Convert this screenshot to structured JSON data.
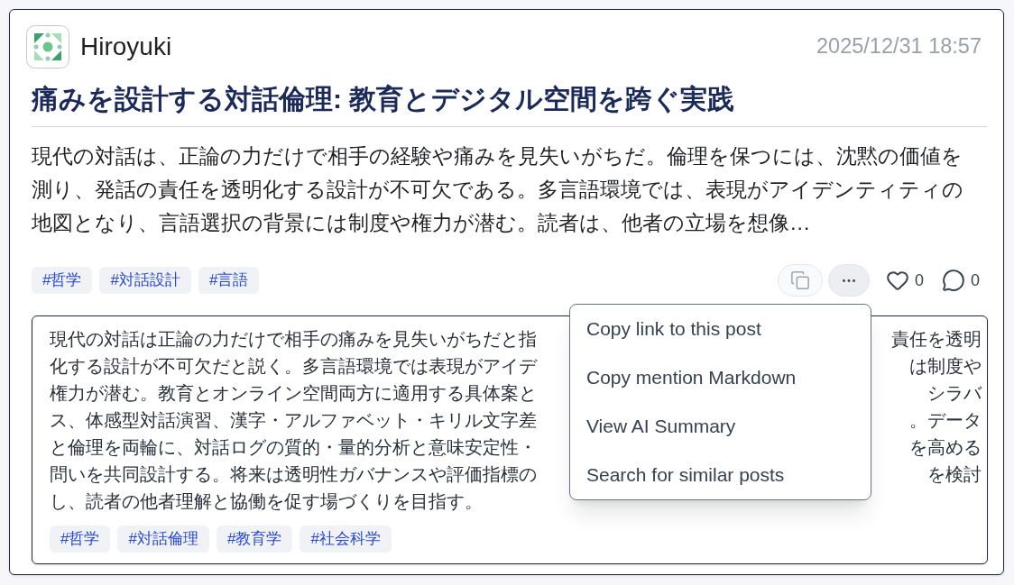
{
  "post": {
    "author": "Hiroyuki",
    "timestamp": "2025/12/31 18:57",
    "title": "痛みを設計する対話倫理: 教育とデジタル空間を跨ぐ実践",
    "body_lines": [
      "現代の対話は、正論の力だけで相手の経験や痛みを見失いがちだ。倫理を保つには、沈黙の価値を",
      "測り、発話の責任を透明化する設計が不可欠である。多言語環境では、表現がアイデンティティの",
      "地図となり、言語選択の背景には制度や権力が潜む。読者は、他者の立場を想像…"
    ],
    "tags": [
      "#哲学",
      "#対話設計",
      "#言語"
    ],
    "likes": "0",
    "comments": "0",
    "more_menu": {
      "open": true,
      "items": [
        "Copy link to this post",
        "Copy mention Markdown",
        "View AI Summary",
        "Search for similar posts"
      ]
    }
  },
  "summary": {
    "lines": [
      {
        "left": "現代の対話は正論の力だけで相手の痛みを見失いがちだと指",
        "right": "責任を透明"
      },
      {
        "left": "化する設計が不可欠だと説く。多言語環境では表現がアイデ",
        "right": "は制度や"
      },
      {
        "left": "権力が潜む。教育とオンライン空間両方に適用する具体案と",
        "right": "シラバ"
      },
      {
        "left": "ス、体感型対話演習、漢字・アルファベット・キリル文字差",
        "right": "。データ"
      },
      {
        "left": "と倫理を両輪に、対話ログの質的・量的分析と意味安定性・",
        "right": "を高める"
      },
      {
        "left": "問いを共同設計する。将来は透明性ガバナンスや評価指標の",
        "right": "を検討"
      },
      {
        "left": "し、読者の他者理解と協働を促す場づくりを目指す。"
      }
    ],
    "tags": [
      "#哲学",
      "#対話倫理",
      "#教育学",
      "#社会科学"
    ]
  }
}
